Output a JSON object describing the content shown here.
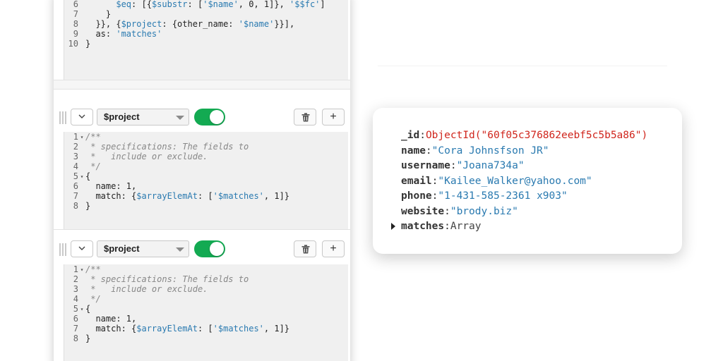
{
  "top_editor": {
    "lines": [
      {
        "num": "6",
        "code": [
          {
            "t": "      ",
            "c": ""
          },
          {
            "t": "$eq",
            "c": "var"
          },
          {
            "t": ": [{",
            "c": ""
          },
          {
            "t": "$substr",
            "c": "var"
          },
          {
            "t": ": [",
            "c": ""
          },
          {
            "t": "'$name'",
            "c": "str"
          },
          {
            "t": ", 0, 1]}, ",
            "c": ""
          },
          {
            "t": "'$$fc'",
            "c": "str"
          },
          {
            "t": "]",
            "c": ""
          }
        ]
      },
      {
        "num": "7",
        "code": [
          {
            "t": "    }",
            "c": ""
          }
        ]
      },
      {
        "num": "8",
        "code": [
          {
            "t": "  }}, {",
            "c": ""
          },
          {
            "t": "$project",
            "c": "var"
          },
          {
            "t": ": {other_name: ",
            "c": ""
          },
          {
            "t": "'$name'",
            "c": "str"
          },
          {
            "t": "}}],",
            "c": ""
          }
        ]
      },
      {
        "num": "9",
        "code": [
          {
            "t": "  as: ",
            "c": ""
          },
          {
            "t": "'matches'",
            "c": "str"
          }
        ]
      },
      {
        "num": "10",
        "code": [
          {
            "t": "}",
            "c": ""
          }
        ]
      }
    ]
  },
  "stages": [
    {
      "operator": "$project",
      "enabled": true,
      "lines": [
        {
          "num": "1",
          "fold": true,
          "code": [
            {
              "t": "/**",
              "c": "cm"
            }
          ]
        },
        {
          "num": "2",
          "code": [
            {
              "t": " * specifications: The fields to",
              "c": "cm"
            }
          ]
        },
        {
          "num": "3",
          "code": [
            {
              "t": " *   include or exclude.",
              "c": "cm"
            }
          ]
        },
        {
          "num": "4",
          "code": [
            {
              "t": " */",
              "c": "cm"
            }
          ]
        },
        {
          "num": "5",
          "fold": true,
          "code": [
            {
              "t": "{",
              "c": ""
            }
          ]
        },
        {
          "num": "6",
          "code": [
            {
              "t": "  name: 1,",
              "c": ""
            }
          ]
        },
        {
          "num": "7",
          "code": [
            {
              "t": "  match: {",
              "c": ""
            },
            {
              "t": "$arrayElemAt",
              "c": "var"
            },
            {
              "t": ": [",
              "c": ""
            },
            {
              "t": "'$matches'",
              "c": "str"
            },
            {
              "t": ", 1]}",
              "c": ""
            }
          ]
        },
        {
          "num": "8",
          "code": [
            {
              "t": "}",
              "c": ""
            }
          ]
        }
      ]
    },
    {
      "operator": "$project",
      "enabled": true,
      "lines": [
        {
          "num": "1",
          "fold": true,
          "code": [
            {
              "t": "/**",
              "c": "cm"
            }
          ]
        },
        {
          "num": "2",
          "code": [
            {
              "t": " * specifications: The fields to",
              "c": "cm"
            }
          ]
        },
        {
          "num": "3",
          "code": [
            {
              "t": " *   include or exclude.",
              "c": "cm"
            }
          ]
        },
        {
          "num": "4",
          "code": [
            {
              "t": " */",
              "c": "cm"
            }
          ]
        },
        {
          "num": "5",
          "fold": true,
          "code": [
            {
              "t": "{",
              "c": ""
            }
          ]
        },
        {
          "num": "6",
          "code": [
            {
              "t": "  name: 1,",
              "c": ""
            }
          ]
        },
        {
          "num": "7",
          "code": [
            {
              "t": "  match: {",
              "c": ""
            },
            {
              "t": "$arrayElemAt",
              "c": "var"
            },
            {
              "t": ": [",
              "c": ""
            },
            {
              "t": "'$matches'",
              "c": "str"
            },
            {
              "t": ", 1]}",
              "c": ""
            }
          ]
        },
        {
          "num": "8",
          "code": [
            {
              "t": "}",
              "c": ""
            }
          ]
        }
      ]
    }
  ],
  "stage_controls": {
    "collapse_icon": "chevron-down-icon",
    "delete_icon": "trash-icon",
    "add_label": "+"
  },
  "document": {
    "fields": [
      {
        "key": "_id",
        "value": "ObjectId(\"60f05c376862eebf5c5b5a86\")",
        "kind": "oid"
      },
      {
        "key": "name",
        "value": "\"Cora Johnsfson JR\"",
        "kind": "str"
      },
      {
        "key": "username",
        "value": "\"Joana734a\"",
        "kind": "str"
      },
      {
        "key": "email",
        "value": "\"Kailee_Walker@yahoo.com\"",
        "kind": "str"
      },
      {
        "key": "phone",
        "value": "\"1-431-585-2361 x903\"",
        "kind": "str"
      },
      {
        "key": "website",
        "value": "\"brody.biz\"",
        "kind": "str"
      },
      {
        "key": "matches",
        "value": "Array",
        "kind": "plain",
        "expandable": true
      }
    ]
  },
  "colors": {
    "toggle_on": "#13aa52",
    "string": "#2a7ab0",
    "object_id": "#d0261d",
    "comment": "#888888"
  }
}
